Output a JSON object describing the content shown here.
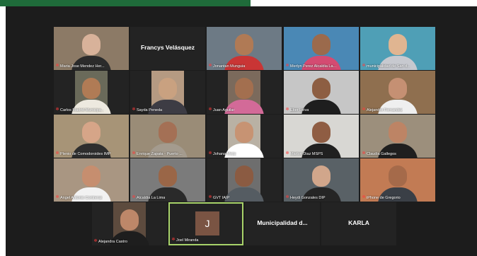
{
  "participants": [
    {
      "name": "Maria Jose Mendez Her...",
      "bg": "#8c7a66",
      "skin": "#d8b29a",
      "shirt": "#2b2b2b"
    },
    {
      "name": "Francys Velásquez",
      "bg": "#232323",
      "skin": "",
      "shirt": "",
      "label_only": true
    },
    {
      "name": "Jonantan Munguia",
      "bg": "#6d7a85",
      "skin": "#b07a55",
      "shirt": "#c93535"
    },
    {
      "name": "Merlyn Perez Alcaldia La...",
      "bg": "#4a88b5",
      "skin": "#9b6a4c",
      "shirt": "#d44b72"
    },
    {
      "name": "municipalidad de San d...",
      "bg": "#4f9fb6",
      "skin": "#e0b591",
      "shirt": "#c7c9cf"
    },
    {
      "name": "Carlos Madrid Municipa...",
      "bg": "#6a6a5a",
      "skin": "#b07b55",
      "shirt": "#ede9df"
    },
    {
      "name": "Sayda Peneda",
      "bg": "#b59a82",
      "skin": "#c9a180",
      "shirt": "#3d3c44"
    },
    {
      "name": "Juan Aguilar",
      "bg": "#7b6a5c",
      "skin": "#a36f4f",
      "shirt": "#d36a98"
    },
    {
      "name": "Eber Leiva",
      "bg": "#c6c6c6",
      "skin": "#8d5e42",
      "shirt": "#1e1e1e"
    },
    {
      "name": "Alejandro Fernandez",
      "bg": "#8f6f4f",
      "skin": "#c59073",
      "shirt": "#efefef"
    },
    {
      "name": "Plenio de Comodoroides IMP",
      "bg": "#a79477",
      "skin": "#d6a588",
      "shirt": "#2e2e2e"
    },
    {
      "name": "Enrique Zapata - Puerto ...",
      "bg": "#9a8c77",
      "skin": "#a47055",
      "shirt": "#a49b8e"
    },
    {
      "name": "Johana Mejia",
      "bg": "#b9b1a4",
      "skin": "#c79373",
      "shirt": "#ffffff"
    },
    {
      "name": "Marlon Diaz MSPS",
      "bg": "#d8d7d3",
      "skin": "#8f5d43",
      "shirt": "#202020"
    },
    {
      "name": "Claudia Gallegos",
      "bg": "#9c8f7c",
      "skin": "#bd8465",
      "shirt": "#1f1f1f"
    },
    {
      "name": "Angel Antonio Contreras",
      "bg": "#a99682",
      "skin": "#c68e6f",
      "shirt": "#f2f2f2"
    },
    {
      "name": "Alcaldia La Lima",
      "bg": "#7b7b7b",
      "skin": "#9a6647",
      "shirt": "#2a2a2a"
    },
    {
      "name": "GVT IAIP",
      "bg": "#6e6e6e",
      "skin": "#8b5b42",
      "shirt": "#555c62"
    },
    {
      "name": "Heydi Gonzales DIP",
      "bg": "#596166",
      "skin": "#d1a68b",
      "shirt": "#252525"
    },
    {
      "name": "iPhone de Gregorio",
      "bg": "#c27b54",
      "skin": "#a56a4a",
      "shirt": "#3a3f46"
    },
    {
      "name": "Alejandra Castro",
      "bg": "#5d4b3e",
      "skin": "#bd8769",
      "shirt": "#1e1e1e"
    },
    {
      "name": "Joel Miranda",
      "bg": "#232323",
      "skin": "",
      "shirt": "",
      "avatar_letter": "J"
    },
    {
      "name": "Municipalidad d...",
      "bg": "#232323",
      "skin": "",
      "shirt": "",
      "label_only": true
    },
    {
      "name": "KARLA",
      "bg": "#232323",
      "skin": "",
      "shirt": "",
      "label_only": true
    }
  ]
}
